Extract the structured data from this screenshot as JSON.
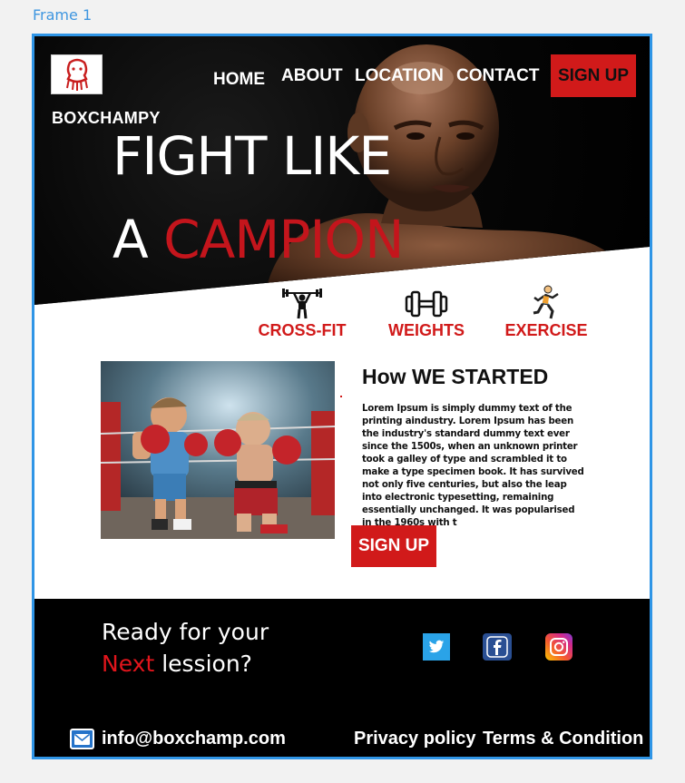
{
  "canvas": {
    "frame_label": "Frame 1"
  },
  "header": {
    "brand": "BOXCHAMPY",
    "nav": [
      "HOME",
      "ABOUT",
      "LOCATION",
      "CONTACT"
    ],
    "signup_label": "SIGN UP",
    "logo_icon": "boxer-head-icon"
  },
  "hero": {
    "headline_line1": "FIGHT LIKE",
    "headline_line2_white": "A",
    "headline_line2_red": "CAMPION"
  },
  "services": [
    {
      "label": "CROSS-FIT",
      "icon": "barbell-lifter-icon"
    },
    {
      "label": "WEIGHTS",
      "icon": "dumbbell-icon"
    },
    {
      "label": "EXERCISE",
      "icon": "runner-icon"
    }
  ],
  "about": {
    "title": "How WE STARTED",
    "text": "Lorem Ipsum is simply dummy text of the printing aindustry. Lorem Ipsum has been the industry's standard dummy text ever since the 1500s, when an unknown printer took a galley of type and scrambled it to make a type specimen book. It has survived not only five centuries, but also the leap into electronic typesetting, remaining essentially unchanged. It was popularised in the 1960s with t",
    "signup_label": "SIGN UP"
  },
  "footer": {
    "cta_line1": "Ready for your",
    "cta_line2_red": "Next",
    "cta_line2_white": "lession?",
    "social": [
      "twitter-icon",
      "facebook-icon",
      "instagram-icon"
    ],
    "email": "info@boxchamp.com",
    "privacy": "Privacy policy",
    "terms": "Terms & Condition"
  },
  "colors": {
    "accent_red": "#d11a1a",
    "frame_blue": "#2f95e6",
    "footer_bg": "#000000"
  }
}
